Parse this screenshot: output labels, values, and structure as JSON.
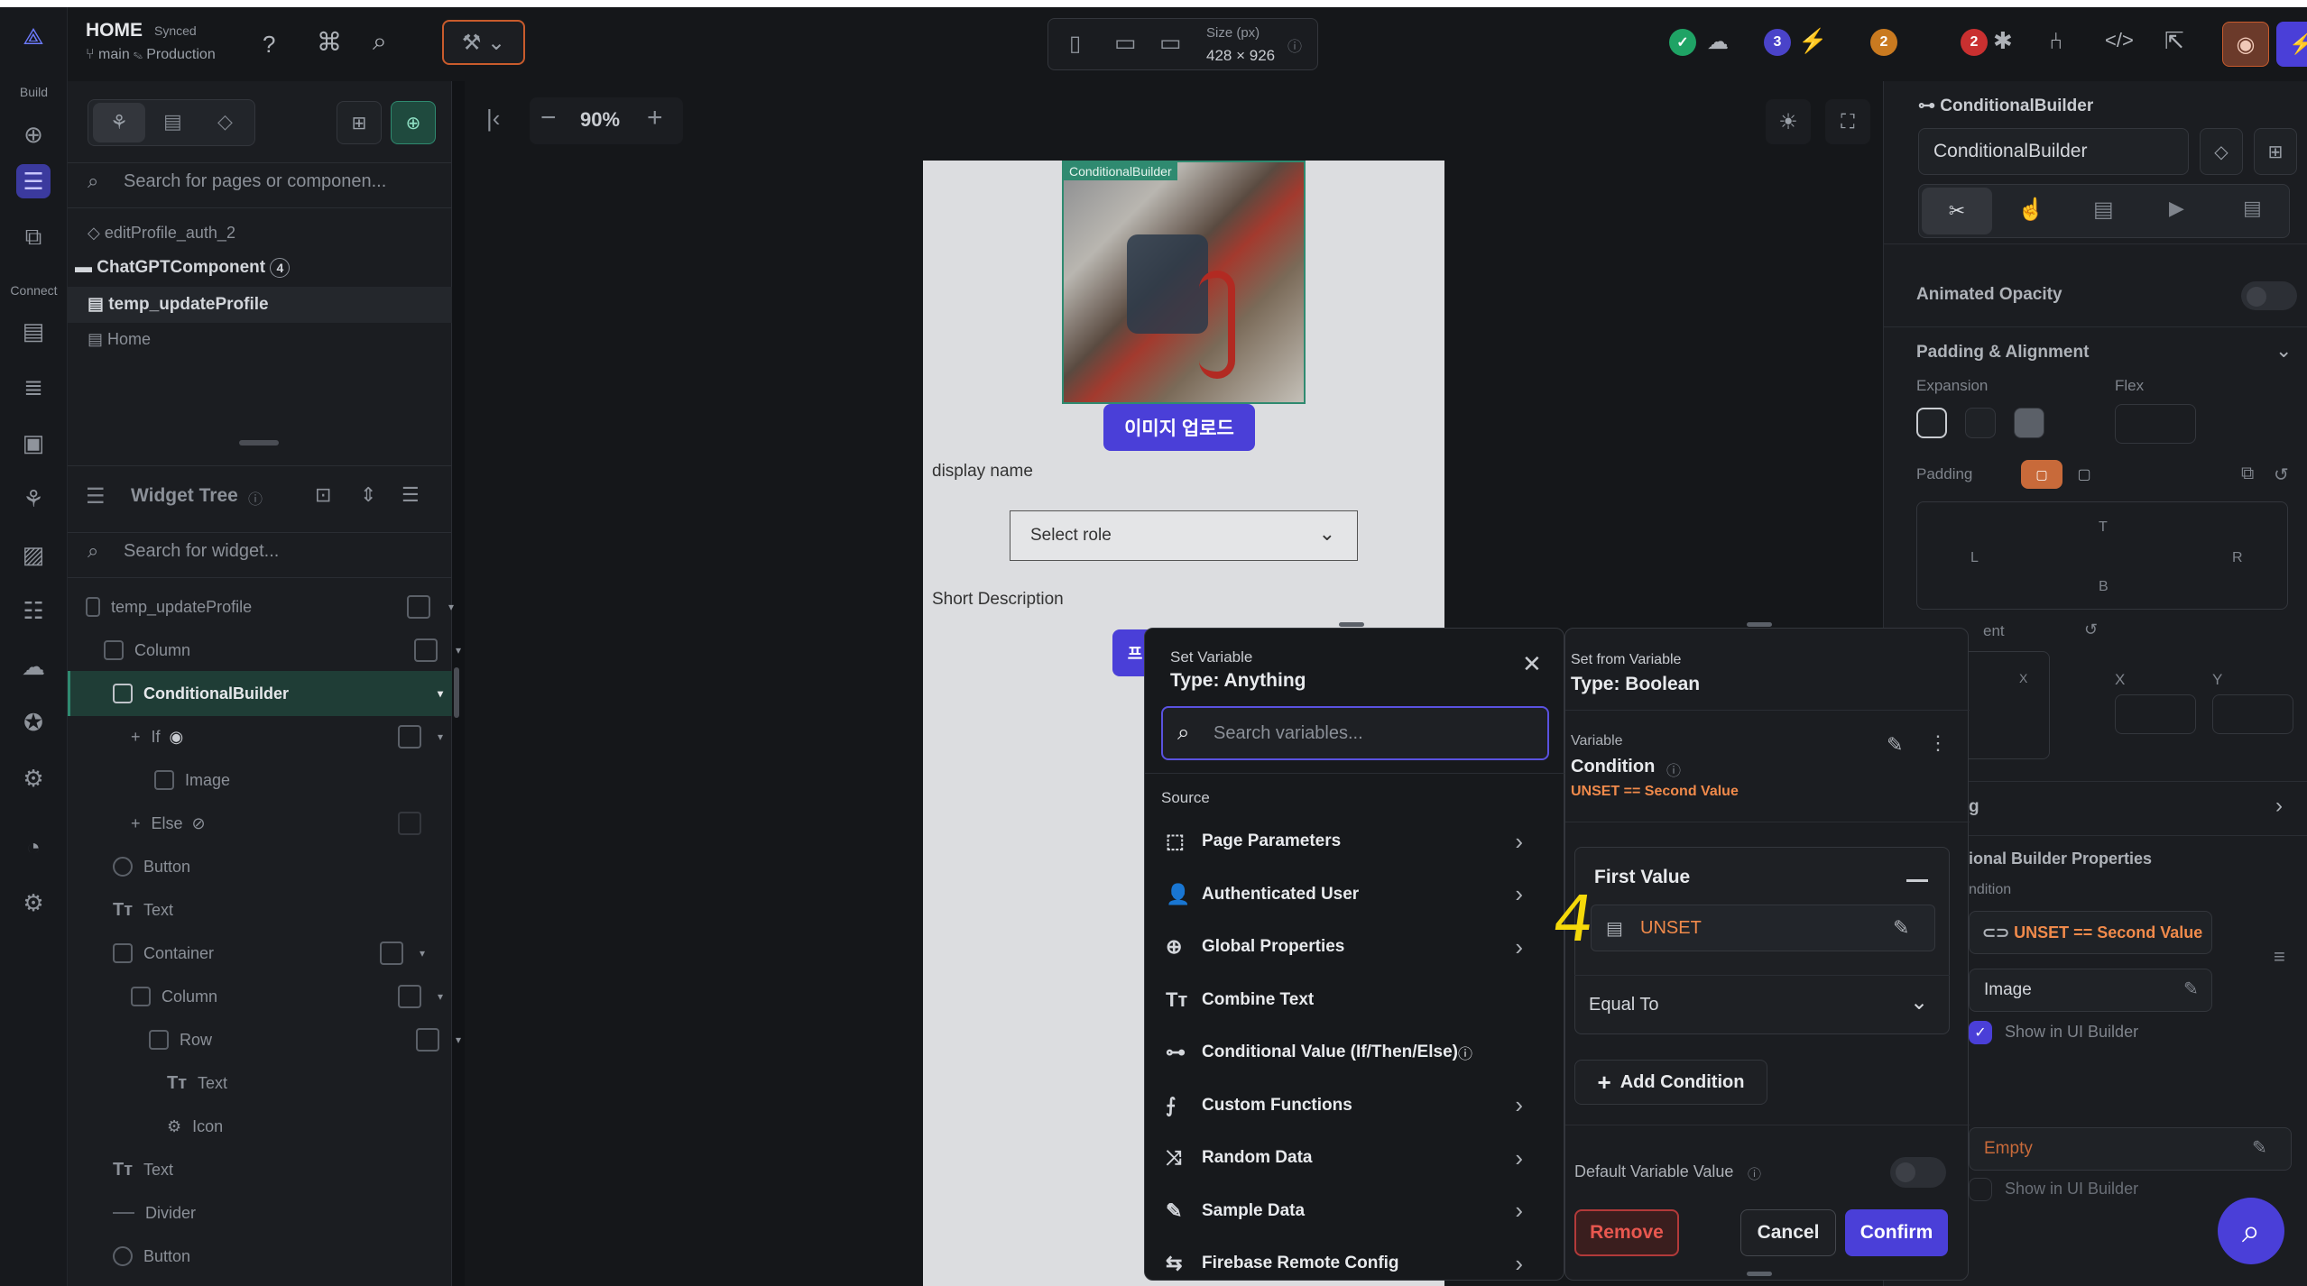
{
  "topbar": {
    "project": "HOME",
    "synced": "Synced",
    "branch": "main",
    "environment": "Production",
    "size_label": "Size (px)",
    "size_value": "428 × 926",
    "badge_blue": "3",
    "badge_orange": "2",
    "badge_red": "2"
  },
  "rail": {
    "build_label": "Build",
    "connect_label": "Connect"
  },
  "left_panel": {
    "page_search_placeholder": "Search for pages or componen...",
    "pages": [
      {
        "label": "editProfile_auth_2"
      },
      {
        "label": "ChatGPTComponent",
        "count": "4"
      },
      {
        "label": "temp_updateProfile"
      },
      {
        "label": "Home"
      }
    ],
    "widget_tree_title": "Widget Tree",
    "widget_search_placeholder": "Search for widget...",
    "tree": [
      {
        "label": "temp_updateProfile"
      },
      {
        "label": "Column"
      },
      {
        "label": "ConditionalBuilder"
      },
      {
        "label": "If"
      },
      {
        "label": "Image"
      },
      {
        "label": "Else"
      },
      {
        "label": "Button"
      },
      {
        "label": "Text"
      },
      {
        "label": "Container"
      },
      {
        "label": "Column"
      },
      {
        "label": "Row"
      },
      {
        "label": "Text"
      },
      {
        "label": "Icon"
      },
      {
        "label": "Text"
      },
      {
        "label": "Divider"
      },
      {
        "label": "Button"
      }
    ]
  },
  "canvas": {
    "zoom": "90%",
    "image_tag": "ConditionalBuilder",
    "upload_button": "이미지 업로드",
    "display_name": "display name",
    "select_placeholder": "Select role",
    "short_description": "Short Description",
    "partial_button": "프"
  },
  "set_variable": {
    "title": "Set Variable",
    "type": "Type: Anything",
    "search_placeholder": "Search variables...",
    "source_label": "Source",
    "sources": [
      {
        "label": "Page Parameters",
        "icon": "page-params-icon",
        "chevron": true
      },
      {
        "label": "Authenticated User",
        "icon": "user-icon",
        "chevron": true
      },
      {
        "label": "Global Properties",
        "icon": "globe-icon",
        "chevron": true
      },
      {
        "label": "Combine Text",
        "icon": "text-icon",
        "chevron": false
      },
      {
        "label": "Conditional Value (If/Then/Else)",
        "icon": "conditional-icon",
        "chevron": false
      },
      {
        "label": "Custom Functions",
        "icon": "function-icon",
        "chevron": true
      },
      {
        "label": "Random Data",
        "icon": "shuffle-icon",
        "chevron": true
      },
      {
        "label": "Sample Data",
        "icon": "sample-icon",
        "chevron": true
      },
      {
        "label": "Firebase Remote Config",
        "icon": "remote-config-icon",
        "chevron": true
      }
    ]
  },
  "set_from_variable": {
    "title": "Set from Variable",
    "type": "Type: Boolean",
    "variable_label": "Variable",
    "condition_label": "Condition",
    "condition_value": "UNSET == Second Value",
    "first_value_label": "First Value",
    "first_value": "UNSET",
    "operator": "Equal To",
    "add_condition": "Add Condition",
    "default_value_label": "Default Variable Value",
    "remove": "Remove",
    "cancel": "Cancel",
    "confirm": "Confirm",
    "annotation": "4"
  },
  "right_panel": {
    "widget_name_label": "ConditionalBuilder",
    "widget_name_value": "ConditionalBuilder",
    "animated_opacity": "Animated Opacity",
    "padding_alignment": "Padding & Alignment",
    "expansion": "Expansion",
    "flex": "Flex",
    "padding": "Padding",
    "t": "T",
    "l": "L",
    "r": "R",
    "b": "B",
    "alignment": "ent",
    "x": "X",
    "y": "Y",
    "section_partial": "g",
    "cb_properties": "ional Builder Properties",
    "condition": "ndition",
    "condition_value": "UNSET == Second Value",
    "image": "Image",
    "show_in_ui_builder": "Show in UI Builder",
    "empty": "Empty",
    "show_in_ui_builder_2": "Show in UI Builder"
  },
  "colors": {
    "accent": "#4a3fd8",
    "orange": "#f08a4b",
    "panel": "#1e2024",
    "annotation": "#f5d90a"
  }
}
